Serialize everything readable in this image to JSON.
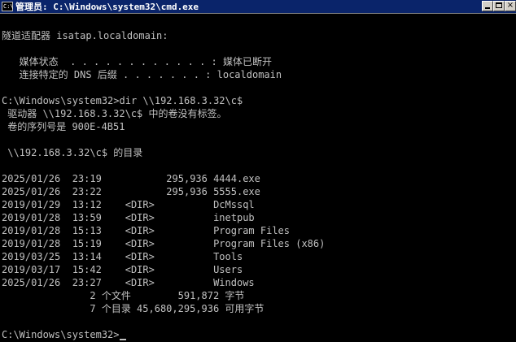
{
  "window": {
    "title": "管理员: C:\\Windows\\system32\\cmd.exe",
    "icon_text": "C:\\",
    "buttons": {
      "minimize": "minimize-icon",
      "maximize": "maximize-icon",
      "close": "×"
    }
  },
  "console": {
    "lines": [
      "",
      "隧道适配器 isatap.localdomain:",
      "",
      "   媒体状态  . . . . . . . . . . . . : 媒体已断开",
      "   连接特定的 DNS 后缀 . . . . . . . : localdomain",
      "",
      "C:\\Windows\\system32>dir \\\\192.168.3.32\\c$",
      " 驱动器 \\\\192.168.3.32\\c$ 中的卷没有标签。",
      " 卷的序列号是 900E-4B51",
      "",
      " \\\\192.168.3.32\\c$ 的目录",
      "",
      "2025/01/26  23:19           295,936 4444.exe",
      "2025/01/26  23:22           295,936 5555.exe",
      "2019/01/29  13:12    <DIR>          DcMssql",
      "2019/01/28  13:59    <DIR>          inetpub",
      "2019/01/28  15:13    <DIR>          Program Files",
      "2019/01/28  15:19    <DIR>          Program Files (x86)",
      "2019/03/25  13:14    <DIR>          Tools",
      "2019/03/17  15:42    <DIR>          Users",
      "2025/01/26  23:27    <DIR>          Windows",
      "               2 个文件        591,872 字节",
      "               7 个目录 45,680,295,936 可用字节",
      "",
      "C:\\Windows\\system32>"
    ]
  },
  "colors": {
    "background": "#000000",
    "text": "#c0c0c0",
    "titlebar": "#0a246a"
  }
}
